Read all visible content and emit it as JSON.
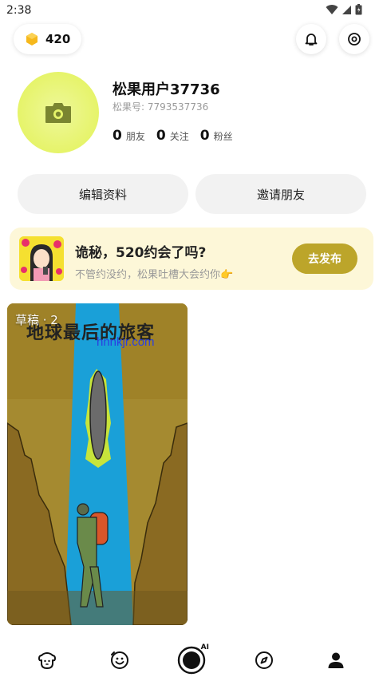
{
  "status_bar": {
    "time": "2:38"
  },
  "header": {
    "coin_count": "420"
  },
  "profile": {
    "username": "松果用户37736",
    "user_id_label": "松果号:",
    "user_id": "7793537736",
    "stats": [
      {
        "num": "0",
        "label": "朋友"
      },
      {
        "num": "0",
        "label": "关注"
      },
      {
        "num": "0",
        "label": "粉丝"
      }
    ]
  },
  "actions": {
    "edit_profile": "编辑资料",
    "invite_friends": "邀请朋友"
  },
  "banner": {
    "title": "诡秘，520约会了吗?",
    "subtitle": "不管约没约，松果吐槽大会约你👉",
    "button": "去发布"
  },
  "draft": {
    "label": "草稿 · 2",
    "cover_title": "地球最后的旅客",
    "cover_watermark": "hnnkjr.com"
  },
  "tabs": [
    {
      "icon": "dog-face-icon"
    },
    {
      "icon": "smile-chat-icon"
    },
    {
      "icon": "ai-create-icon",
      "badge": "AI"
    },
    {
      "icon": "compass-icon"
    },
    {
      "icon": "person-icon"
    }
  ],
  "colors": {
    "accent": "#bca52a",
    "avatar": "#e6f46a",
    "banner_bg": "#fdf7d8"
  }
}
